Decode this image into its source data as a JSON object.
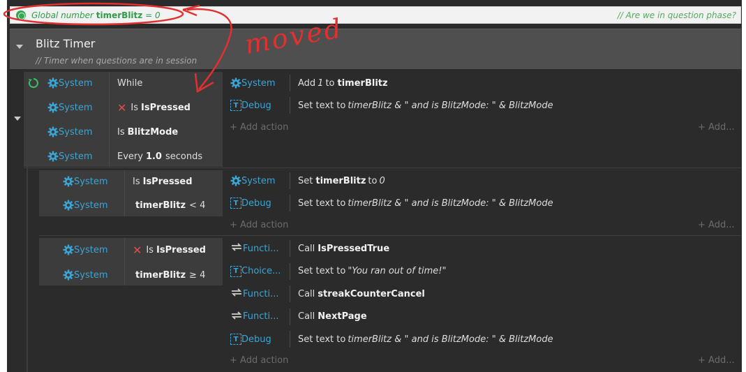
{
  "global_var": {
    "prefix": "Global number",
    "name": "timerBlitz",
    "value": "= 0",
    "comment": "//  Are we in question phase?"
  },
  "group": {
    "title": "Blitz Timer",
    "comment": "//  Timer when questions are in session"
  },
  "events": [
    {
      "conditions": [
        {
          "object": "System",
          "pre": "While",
          "bold": "",
          "post": ""
        },
        {
          "object": "System",
          "pre": "Is",
          "bold": "IsPressed",
          "post": "",
          "inverted": true
        },
        {
          "object": "System",
          "pre": "Is",
          "bold": "BlitzMode",
          "post": ""
        },
        {
          "object": "System",
          "pre": "Every",
          "bold": "1.0",
          "post": "seconds"
        }
      ],
      "actions": [
        {
          "object": "System",
          "text": "Add",
          "italic": "1",
          "text2": "to",
          "bold": "timerBlitz"
        },
        {
          "object": "Debug",
          "text": "Set text to",
          "italic": "timerBlitz & \" and is BlitzMode: \" & BlitzMode"
        }
      ]
    },
    {
      "conditions": [
        {
          "object": "System",
          "pre": "Is",
          "bold": "IsPressed",
          "post": ""
        },
        {
          "object": "System",
          "pre": "",
          "bold": "timerBlitz",
          "post": "< 4"
        }
      ],
      "actions": [
        {
          "object": "System",
          "text": "Set",
          "bold": "timerBlitz",
          "text2": "to",
          "italic": "0"
        },
        {
          "object": "Debug",
          "text": "Set text to",
          "italic": "timerBlitz & \" and is BlitzMode: \" & BlitzMode"
        }
      ]
    },
    {
      "conditions": [
        {
          "object": "System",
          "pre": "Is",
          "bold": "IsPressed",
          "post": "",
          "inverted": true
        },
        {
          "object": "System",
          "pre": "",
          "bold": "timerBlitz",
          "post": "≥ 4"
        }
      ],
      "actions": [
        {
          "object": "Functi...",
          "text": "Call",
          "bold": "IsPressedTrue"
        },
        {
          "object": "Choice...",
          "text": "Set text to",
          "italic": "\"You ran out of time!\""
        },
        {
          "object": "Functi...",
          "text": "Call",
          "bold": "streakCounterCancel"
        },
        {
          "object": "Functi...",
          "text": "Call",
          "bold": "NextPage"
        },
        {
          "object": "Debug",
          "text": "Set text to",
          "italic": "timerBlitz & \" and is BlitzMode: \" & BlitzMode"
        }
      ]
    }
  ],
  "add_action_label": "+ Add action",
  "add_right_label": "+ Add...",
  "annotation": {
    "text": "moved",
    "color": "#e23030"
  }
}
